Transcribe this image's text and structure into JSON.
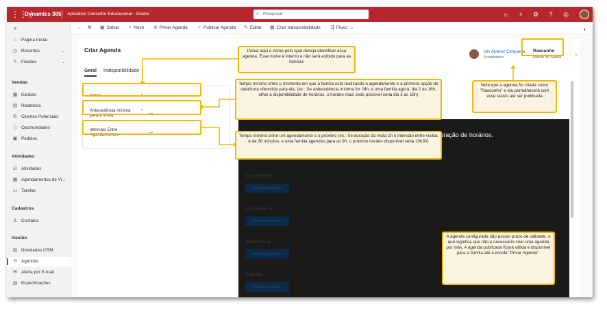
{
  "topbar": {
    "brand": "Dynamics 365",
    "app_name": "Aplicativo Consultor Educacional - Gestor",
    "search_placeholder": "Pesquisar"
  },
  "sidebar": {
    "items_top": [
      {
        "label": "Página Inicial",
        "icon": "home-icon"
      },
      {
        "label": "Recentes",
        "icon": "clock-icon",
        "chevron": true
      },
      {
        "label": "Fixados",
        "icon": "pin-icon",
        "chevron": true
      }
    ],
    "groups": [
      {
        "title": "Vendas",
        "items": [
          "Kanban",
          "Relatórios",
          "Clientes Potenciais",
          "Oportunidades",
          "Pedidos"
        ]
      },
      {
        "title": "Atividades",
        "items": [
          "Atividades",
          "Agendamentos de Vi...",
          "Tarefas"
        ]
      },
      {
        "title": "Cadastros",
        "items": [
          "Contatos"
        ]
      },
      {
        "title": "Gestão",
        "items": [
          "Novidades CRM",
          "Agendas",
          "Alerta por E-mail",
          "Especificações"
        ]
      }
    ],
    "active_item": "Agendas"
  },
  "commandbar": {
    "save": "Salvar",
    "new": "Novo",
    "private": "Privar Agenda",
    "publish": "Publicar Agenda",
    "edit": "Editar",
    "unavailability": "Criar Indisponibilidade",
    "flow": "Fluxo"
  },
  "form": {
    "title": "Criar Agenda",
    "tabs": [
      "Geral",
      "Indisponibilidade"
    ],
    "fields": [
      {
        "label": "Nome",
        "value": "---"
      },
      {
        "label": "Antecedência mínima",
        "label2": "para a Visita",
        "value": "---"
      },
      {
        "label": "Intervalo Entre",
        "label2": "Agendamentos",
        "value": "---"
      }
    ],
    "owner": {
      "name": "Isis Alvarez Cerqueira",
      "role": "Proprietário"
    },
    "status": {
      "value": "Rascunho",
      "label": "Razão do Status"
    }
  },
  "schedule": {
    "message": "Salve a agenda para exibir a página de configuração de horários.",
    "days": [
      "Quarta-feira",
      "Quinta-feira",
      "Sexta-feira",
      "Sábado"
    ],
    "add_button": "Adicionar horário"
  },
  "annotations": {
    "name_note": "Inclua aqui o nome pelo qual deseja identificar essa agenda. Esse nome é interno e não será exibido para as famílias",
    "advance_note": "Tempo mínimo entre o momento em que a família está realizando o agendamento e a primeira opção de data/hora oferecida para ela. (ex.: Se antecedência mínima for 24h, e uma família agora, dia 2 as 16h, olhar a disponibilidade de horários, o horário mais cedo possível seria dia 3 as 16h)",
    "interval_note": "Tempo mínimo entre um agendamento e o próximo (ex.: Se duração da visita 1h e intervalo entre visitas é de 30 minutos, e uma família agendou para as 9h, o próximo horário disponível seria 10h30)",
    "status_note": "Note que a agenda foi criada como \"Rascunho\" e ela permanecerá com esse status até ser publicada",
    "validity_note": "A agenda configurada não possui prazo de validade, o que significa que não é necessário criar uma agenda por mês. A agenda publicada ficará válida e disponível para a família até a escola \"Privar Agenda\"."
  }
}
